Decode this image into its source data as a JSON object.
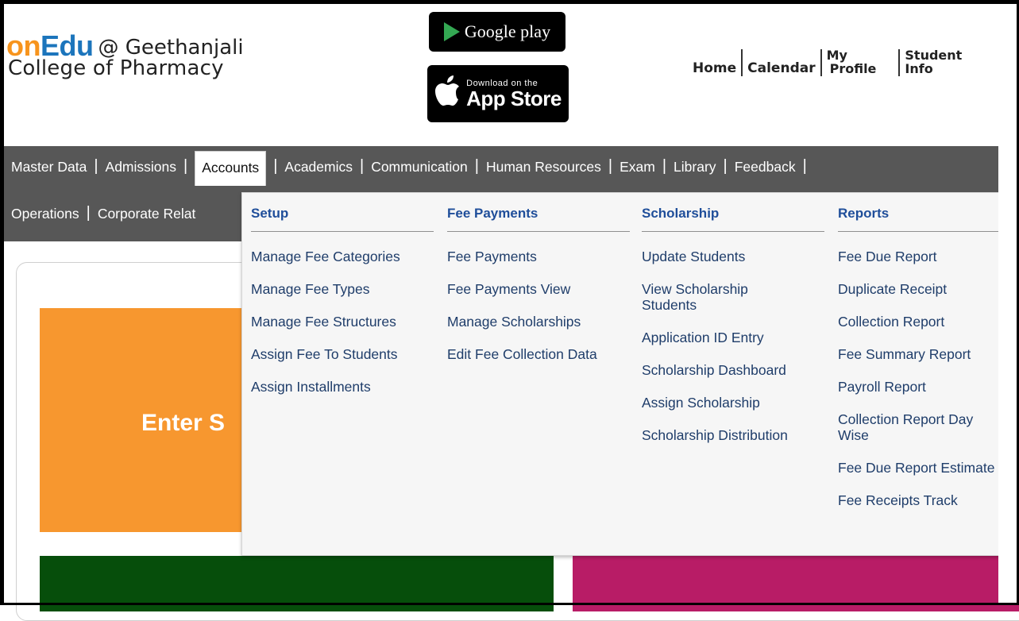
{
  "header": {
    "brand_on": "on",
    "brand_edu": "Edu",
    "brand_at": "@ Geethanjali",
    "college": "College of Pharmacy",
    "badges": {
      "google_play": "Google play",
      "app_store_small": "Download on the",
      "app_store_big": "App Store"
    },
    "links": {
      "home": "Home",
      "calendar": "Calendar",
      "my": "My",
      "profile": "Profile",
      "student": "Student",
      "info": "Info"
    }
  },
  "nav": {
    "row1": [
      "Master Data",
      "Admissions",
      "Accounts",
      "Academics",
      "Communication",
      "Human Resources",
      "Exam",
      "Library",
      "Feedback"
    ],
    "row2": [
      "Operations",
      "Corporate Relat"
    ],
    "active": "Accounts"
  },
  "dropdown": {
    "setup": {
      "heading": "Setup",
      "items": [
        "Manage Fee Categories",
        "Manage Fee Types",
        "Manage Fee Structures",
        "Assign Fee To Students",
        "Assign Installments"
      ]
    },
    "fee_payments": {
      "heading": "Fee Payments",
      "items": [
        "Fee Payments",
        "Fee Payments View",
        "Manage Scholarships",
        "Edit Fee Collection Data"
      ]
    },
    "scholarship": {
      "heading": "Scholarship",
      "items": [
        "Update Students",
        "View Scholarship Students",
        "Application ID Entry",
        "Scholarship Dashboard",
        "Assign Scholarship",
        "Scholarship Distribution"
      ]
    },
    "reports": {
      "heading": "Reports",
      "items": [
        "Fee Due Report",
        "Duplicate Receipt",
        "Collection Report",
        "Fee Summary Report",
        "Payroll Report",
        "Collection Report Day Wise",
        "Fee Due Report Estimate",
        "Fee Receipts Track"
      ]
    }
  },
  "content": {
    "orange_text": "Enter S"
  },
  "colors": {
    "brand_orange": "#f7941d",
    "brand_blue": "#1c75bc",
    "nav_bg": "#575757",
    "menu_heading": "#1f4e9a",
    "orange_tile": "#f7972f",
    "green_tile": "#064e0b",
    "magenta_tile": "#b81c66"
  }
}
